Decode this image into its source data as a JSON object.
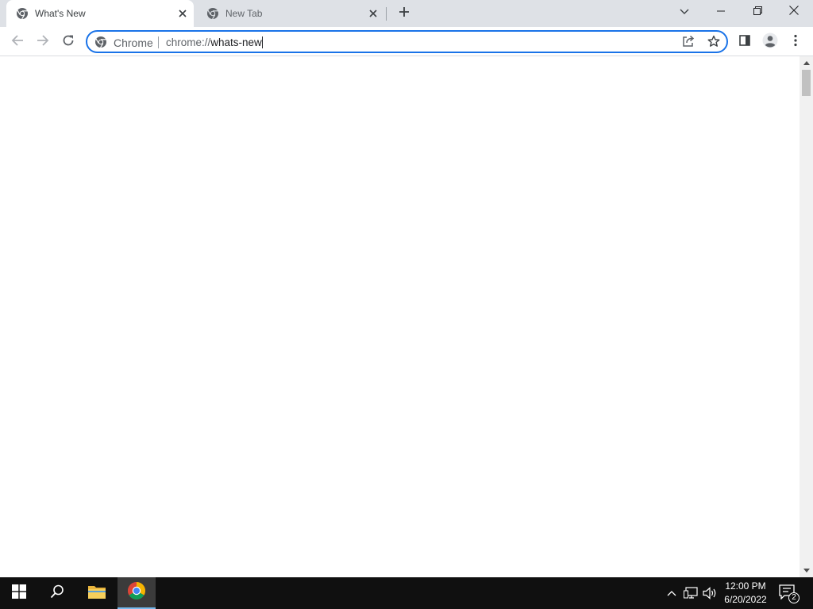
{
  "tabs": [
    {
      "title": "What's New",
      "favicon": "chrome-icon",
      "active": true
    },
    {
      "title": "New Tab",
      "favicon": "chrome-icon",
      "active": false
    }
  ],
  "window_controls": [
    "tab-search-icon",
    "minimize-icon",
    "restore-icon",
    "close-icon"
  ],
  "omnibox": {
    "chip_label": "Chrome",
    "url_scheme": "chrome://",
    "url_host": "whats-new"
  },
  "toolbar_icons": [
    "back-icon",
    "forward-icon",
    "reload-icon",
    "share-icon",
    "bookmark-star-icon",
    "side-panel-icon",
    "profile-icon",
    "menu-icon"
  ],
  "taskbar": {
    "apps": [
      "windows-start-icon",
      "search-icon",
      "file-explorer-icon",
      "chrome-icon"
    ],
    "tray_icons": [
      "show-hidden-icons-icon",
      "network-icon",
      "volume-icon"
    ],
    "time": "12:00 PM",
    "date": "6/20/2022",
    "notification_count": "2"
  },
  "colors": {
    "tabstrip": "#dee1e6",
    "omnibox_focus": "#1a73e8",
    "taskbar": "#101010",
    "taskbar_active_indicator": "#76b9ed"
  }
}
